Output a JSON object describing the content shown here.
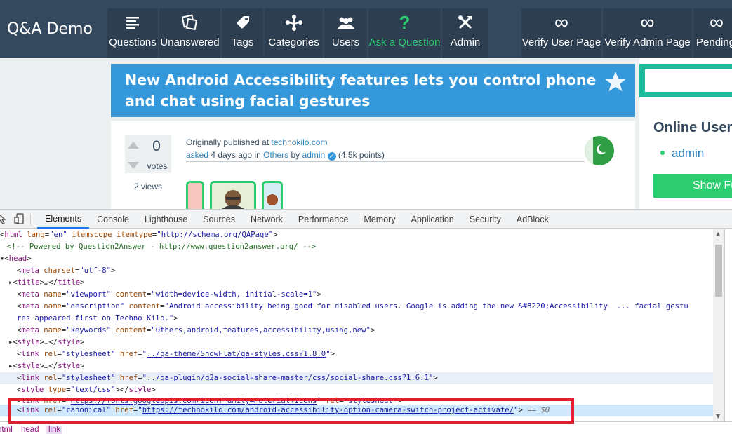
{
  "site": {
    "logo": "Q&A Demo"
  },
  "nav": {
    "items": [
      {
        "label": "Questions",
        "icon": "questions-icon"
      },
      {
        "label": "Unanswered",
        "icon": "unanswered-icon"
      },
      {
        "label": "Tags",
        "icon": "tag-icon"
      },
      {
        "label": "Categories",
        "icon": "categories-icon"
      },
      {
        "label": "Users",
        "icon": "users-icon"
      },
      {
        "label": "Ask a Question",
        "icon": "question-mark-icon"
      },
      {
        "label": "Admin",
        "icon": "admin-tools-icon"
      }
    ],
    "extra": [
      {
        "label": "Verify User Page",
        "icon": "infinity-icon"
      },
      {
        "label": "Verify Admin Page",
        "icon": "infinity-icon"
      },
      {
        "label": "Pending",
        "icon": "infinity-icon"
      }
    ],
    "infinity_symbol": "∞",
    "question_symbol": "?"
  },
  "question": {
    "title": "New Android Accessibility features lets you control phone and chat using facial gestures",
    "votes": "0",
    "votes_label": "votes",
    "views": "2 views",
    "published_prefix": "Originally published at",
    "published_source": "technokilo.com",
    "asked": "asked",
    "when": "4 days ago",
    "in": "in",
    "category": "Others",
    "by": "by",
    "author": "admin",
    "points": "(4.5k points)",
    "verified_glyph": "✓"
  },
  "sidebar": {
    "online_title": "Online User",
    "online_users": [
      "admin"
    ],
    "show_button": "Show Fu"
  },
  "devtools": {
    "tabs": [
      "Elements",
      "Console",
      "Lighthouse",
      "Sources",
      "Network",
      "Performance",
      "Memory",
      "Application",
      "Security",
      "AdBlock"
    ],
    "active_tab": "Elements",
    "lines": [
      "<html lang=\"en\" itemscope itemtype=\"http://schema.org/QAPage\">",
      "<!-- Powered by Question2Answer - http://www.question2answer.org/ -->",
      "<head>",
      "<meta charset=\"utf-8\">",
      "<title>…</title>",
      "<meta name=\"viewport\" content=\"width=device-width, initial-scale=1\">",
      "<meta name=\"description\" content=\"Android accessibility being good for disabled users. Google is adding the new &#8220;Accessibility  ... facial gestu",
      "res appeared first on Techno Kilo.\">",
      "<meta name=\"keywords\" content=\"Others,android,features,accessibility,using,new\">",
      "<style>…</style>",
      "<link rel=\"stylesheet\" href=\"../qa-theme/SnowFlat/qa-styles.css?1.8.0\">",
      "<style>…</style>",
      "<link rel=\"stylesheet\" href=\"../qa-plugin/q2a-social-share-master/css/social-share.css?1.6.1\">",
      "<style type=\"text/css\"></style>",
      "<link href=\"https://fonts.googleapis.com/icon?family=Material+Icons\" rel=\"stylesheet\">",
      "<link rel=\"canonical\" href=\"https://technokilo.com/android-accessibility-option-camera-switch-project-activate/\"> == $0"
    ],
    "canonical_url": "https://technokilo.com/android-accessibility-option-camera-switch-project-activate/",
    "selected_marker": "== $0",
    "breadcrumbs": [
      "html",
      "head",
      "link"
    ]
  }
}
